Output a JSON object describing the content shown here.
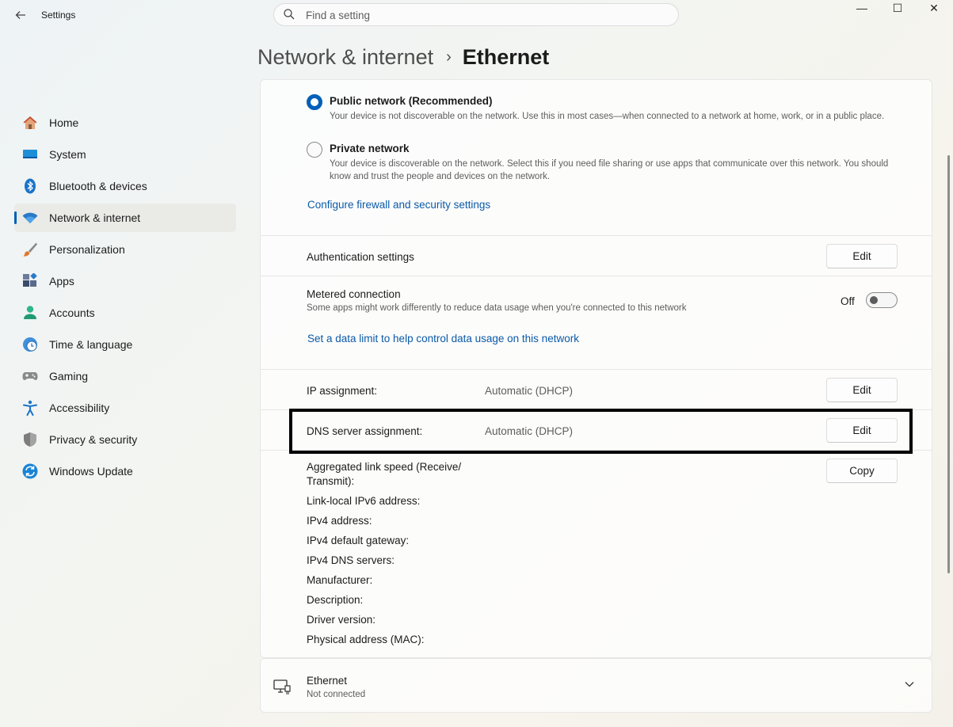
{
  "window": {
    "title": "Settings",
    "search_placeholder": "Find a setting",
    "controls": {
      "minimize": "—",
      "maximize": "☐",
      "close": "✕"
    }
  },
  "breadcrumb": {
    "parent": "Network & internet",
    "separator": "›",
    "current": "Ethernet"
  },
  "sidebar": {
    "items": [
      {
        "label": "Home",
        "icon": "home-icon"
      },
      {
        "label": "System",
        "icon": "system-icon"
      },
      {
        "label": "Bluetooth & devices",
        "icon": "bluetooth-icon"
      },
      {
        "label": "Network & internet",
        "icon": "wifi-icon",
        "active": true
      },
      {
        "label": "Personalization",
        "icon": "brush-icon"
      },
      {
        "label": "Apps",
        "icon": "apps-icon"
      },
      {
        "label": "Accounts",
        "icon": "person-icon"
      },
      {
        "label": "Time & language",
        "icon": "clock-globe-icon"
      },
      {
        "label": "Gaming",
        "icon": "gamepad-icon"
      },
      {
        "label": "Accessibility",
        "icon": "accessibility-icon"
      },
      {
        "label": "Privacy & security",
        "icon": "shield-icon"
      },
      {
        "label": "Windows Update",
        "icon": "update-icon"
      }
    ]
  },
  "network_profile": {
    "public": {
      "title": "Public network (Recommended)",
      "desc": "Your device is not discoverable on the network. Use this in most cases—when connected to a network at home, work, or in a public place.",
      "selected": true
    },
    "private": {
      "title": "Private network",
      "desc": "Your device is discoverable on the network. Select this if you need file sharing or use apps that communicate over this network. You should know and trust the people and devices on the network.",
      "selected": false
    },
    "firewall_link": "Configure firewall and security settings"
  },
  "authentication": {
    "label": "Authentication settings",
    "button": "Edit"
  },
  "metered": {
    "label": "Metered connection",
    "desc": "Some apps might work differently to reduce data usage when you're connected to this network",
    "state": "Off",
    "data_limit_link": "Set a data limit to help control data usage on this network"
  },
  "ip_assignment": {
    "label": "IP assignment:",
    "value": "Automatic (DHCP)",
    "button": "Edit"
  },
  "dns_assignment": {
    "label": "DNS server assignment:",
    "value": "Automatic (DHCP)",
    "button": "Edit"
  },
  "properties": {
    "copy_button": "Copy",
    "items": [
      "Aggregated link speed (Receive/ Transmit):",
      "Link-local IPv6 address:",
      "IPv4 address:",
      "IPv4 default gateway:",
      "IPv4 DNS servers:",
      "Manufacturer:",
      "Description:",
      "Driver version:",
      "Physical address (MAC):"
    ]
  },
  "ethernet_adapter": {
    "title": "Ethernet",
    "status": "Not connected"
  },
  "colors": {
    "accent": "#005fb8",
    "link": "#0b5aa8",
    "highlight_border": "#000000"
  }
}
